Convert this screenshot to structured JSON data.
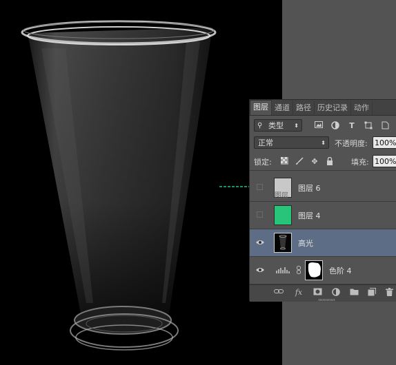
{
  "panel": {
    "tabs": [
      "图层",
      "通道",
      "路径",
      "历史记录",
      "动作"
    ],
    "filter": {
      "label": "类型",
      "icon": "search-icon"
    },
    "blend_mode": "正常",
    "opacity_label": "不透明度:",
    "opacity_value": "100%",
    "lock_label": "锁定:",
    "fill_label": "填充:",
    "fill_value": "100%",
    "layers": [
      {
        "name": "图层 6",
        "visible": false,
        "selected": false,
        "thumb_color": "#c8c8c8",
        "thumb_text": "图层"
      },
      {
        "name": "图层 4",
        "visible": false,
        "selected": false,
        "thumb_color": "#27c47a"
      },
      {
        "name": "高光",
        "visible": true,
        "selected": true,
        "thumb_color": "#050505"
      },
      {
        "name": "色阶 4",
        "visible": true,
        "selected": false,
        "thumb_color": "#000000"
      }
    ]
  },
  "colors": {
    "workspace": "#535353",
    "panel": "#535353",
    "selected_row": "#5c6d85",
    "green_layer": "#27c47a"
  }
}
